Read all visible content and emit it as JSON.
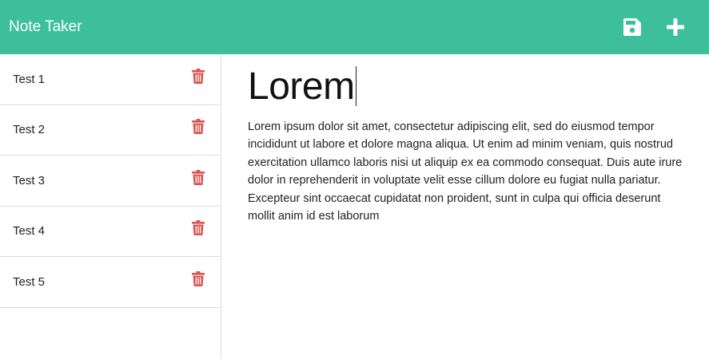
{
  "header": {
    "brand": "Note Taker",
    "save_icon": "save-icon",
    "new_icon": "plus-icon",
    "background": "#3ebf9c"
  },
  "sidebar": {
    "notes": [
      {
        "title": "Test 1",
        "icon": "trash-icon"
      },
      {
        "title": "Test 2",
        "icon": "trash-icon"
      },
      {
        "title": "Test 3",
        "icon": "trash-icon"
      },
      {
        "title": "Test 4",
        "icon": "trash-icon"
      },
      {
        "title": "Test 5",
        "icon": "trash-icon"
      }
    ],
    "trash_color": "#d9534f"
  },
  "editor": {
    "title": "Lorem",
    "body": "Lorem ipsum dolor sit amet, consectetur adipiscing elit, sed do eiusmod tempor incididunt ut labore et dolore magna aliqua. Ut enim ad minim veniam, quis nostrud exercitation ullamco laboris nisi ut aliquip ex ea commodo consequat. Duis aute irure dolor in reprehenderit in voluptate velit esse cillum dolore eu fugiat nulla pariatur. Excepteur sint occaecat cupidatat non proident, sunt in culpa qui officia deserunt mollit anim id est laborum"
  }
}
